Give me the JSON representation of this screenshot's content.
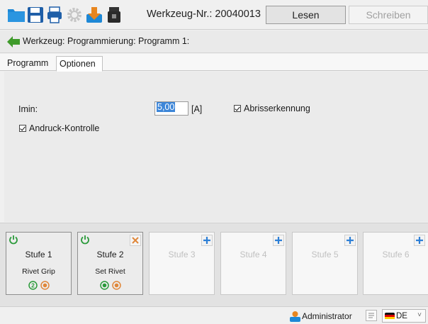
{
  "toolbar": {
    "icons": [
      "folder-icon",
      "save-icon",
      "print-icon",
      "gear-icon",
      "download-icon",
      "usb-icon"
    ],
    "tool_number": "Werkzeug-Nr.: 20040013",
    "read_label": "Lesen",
    "write_label": "Schreiben"
  },
  "breadcrumb": {
    "text": "Werkzeug: Programmierung: Programm 1:"
  },
  "tabs": [
    {
      "label": "Programm",
      "active": false
    },
    {
      "label": "Optionen",
      "active": true
    }
  ],
  "options": {
    "imin_label": "Imin:",
    "imin_value": "5,00",
    "imin_unit": "[A]",
    "abriss_label": "Abrisserkennung",
    "abriss_checked": true,
    "andruck_label": "Andruck-Kontrolle",
    "andruck_checked": true
  },
  "stages": [
    {
      "title": "Stufe 1",
      "subtitle": "Rivet Grip",
      "state": "active",
      "status_badge": "2"
    },
    {
      "title": "Stufe 2",
      "subtitle": "Set Rivet",
      "state": "active"
    },
    {
      "title": "Stufe 3",
      "state": "empty"
    },
    {
      "title": "Stufe 4",
      "state": "empty"
    },
    {
      "title": "Stufe 5",
      "state": "empty"
    },
    {
      "title": "Stufe 6",
      "state": "empty"
    }
  ],
  "statusbar": {
    "user": "Administrator",
    "language": "DE"
  },
  "colors": {
    "accent_green": "#2a9a3a",
    "accent_blue": "#2d7fd6",
    "accent_orange": "#e0873a",
    "selection": "#3d86d8"
  }
}
